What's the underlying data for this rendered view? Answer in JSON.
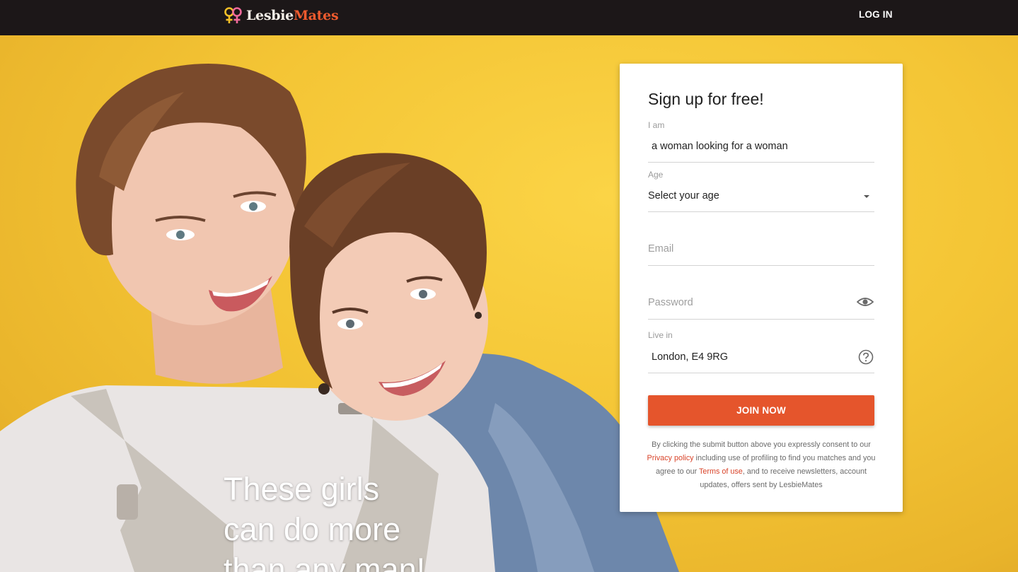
{
  "header": {
    "logo_part1": "Lesbie",
    "logo_part2": "Mates",
    "login_label": "LOG IN"
  },
  "hero": {
    "tagline_line1": "These girls",
    "tagline_line2": "can do more",
    "tagline_line3": "than any man!"
  },
  "signup": {
    "title": "Sign up for free!",
    "i_am_label": "I am",
    "i_am_value": "a woman looking for a woman",
    "age_label": "Age",
    "age_value": "Select your age",
    "email_placeholder": "Email",
    "password_placeholder": "Password",
    "live_in_label": "Live in",
    "live_in_value": "London, E4 9RG",
    "join_label": "JOIN NOW",
    "legal_1": "By clicking the submit button above you expressly consent to our ",
    "legal_privacy": "Privacy policy",
    "legal_2": " including use of profiling to find you matches and you agree to our ",
    "legal_terms": "Terms of use",
    "legal_3": ", and to receive newsletters, account updates, offers sent by LesbieMates"
  },
  "colors": {
    "topbar": "#1c1718",
    "accent": "#e5552c",
    "hero_bg": "#f4c535"
  },
  "icons": {
    "logo": "venus-pair-icon",
    "age_dropdown": "chevron-down-icon",
    "password_toggle": "eye-icon",
    "location_help": "question-circle-icon"
  }
}
